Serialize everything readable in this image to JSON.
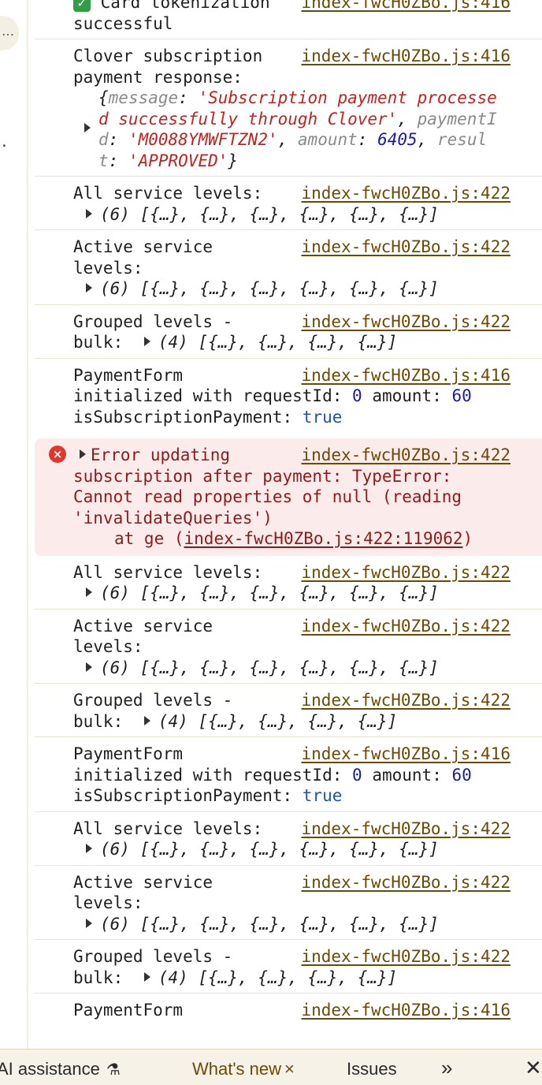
{
  "gutter": {
    "pill_text": "…",
    "dot_text": "."
  },
  "source": {
    "src416": "index-fwcH0ZBo.js:416",
    "src422": "index-fwcH0ZBo.js:422",
    "src_line": "index-fwcH0ZBo.js:422:119062"
  },
  "entries": {
    "tokenization": {
      "text": "Card tokenization",
      "line2": "successful"
    },
    "clover": {
      "line1": "Clover subscription",
      "line2": "payment response:",
      "obj_open": "{",
      "k_message": "message",
      "v_message": "'Subscription payment processe d successfully through Clover'",
      "k_paymentId": "paymentI d",
      "v_paymentId": "'M0088YMWFTZN2'",
      "k_amount": "amount",
      "v_amount": "6405",
      "k_result": "resul t",
      "v_result": "'APPROVED'",
      "obj_close": "}"
    },
    "all_levels": {
      "label": "All service levels:",
      "value": "(6) [{…}, {…}, {…}, {…}, {…}, {…}]"
    },
    "active_levels": {
      "line1": "Active service",
      "line2": "levels:",
      "value": "(6) [{…}, {…}, {…}, {…}, {…}, {…}]"
    },
    "grouped": {
      "line1": "Grouped levels -",
      "line2": "bulk:",
      "value": "(4) [{…}, {…}, {…}, {…}]"
    },
    "payment_form": {
      "line1": "PaymentForm",
      "line2a": "initialized with requestId:",
      "request_id": "0",
      "amount_label": "amount:",
      "amount": "60",
      "line3": "isSubscriptionPayment:",
      "is_sub": "true"
    },
    "error": {
      "line1": "Error updating",
      "line2": "subscription after payment: TypeError:",
      "line3": "Cannot read properties of null (reading",
      "line4": "'invalidateQueries')",
      "at_text": "at ge (",
      "at_close": ")"
    },
    "cut_off": {
      "text": "PaymentForm"
    }
  },
  "bottom_bar": {
    "ai": "AI assistance",
    "whats_new": "What's new",
    "issues": "Issues",
    "more": "»",
    "close": "✕",
    "tab_close": "×"
  },
  "colors": {
    "error_bg": "#fcebeb",
    "error_text": "#8e1a1a",
    "link": "#6b4a06",
    "number": "#1a1aa6",
    "string": "#c5221f"
  }
}
